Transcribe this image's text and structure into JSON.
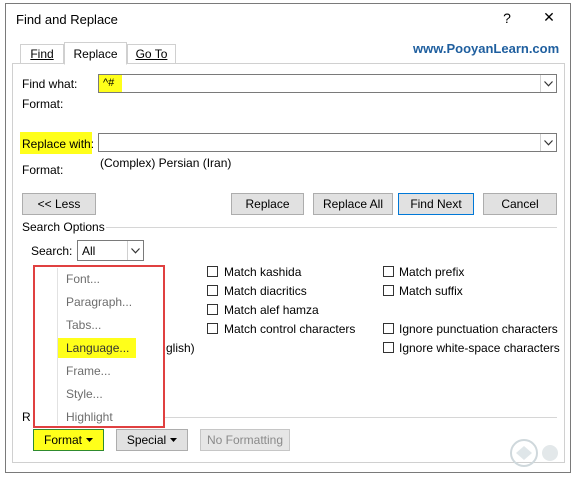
{
  "window": {
    "title": "Find and Replace",
    "help_glyph": "?",
    "close_glyph": "✕"
  },
  "tabs": [
    {
      "label": "Find"
    },
    {
      "label": "Replace"
    },
    {
      "label": "Go To"
    }
  ],
  "watermark": "www.PooyanLearn.com",
  "find": {
    "label": "Find what:",
    "value": "^#",
    "format_label": "Format:"
  },
  "replace": {
    "label": "Replace with:",
    "value": "",
    "format_label": "Format:",
    "format_value": "(Complex) Persian (Iran)"
  },
  "buttons": {
    "less": "<< Less",
    "replace": "Replace",
    "replace_all": "Replace All",
    "find_next": "Find Next",
    "cancel": "Cancel"
  },
  "search_options": {
    "heading": "Search Options",
    "search_label": "Search:",
    "search_value": "All"
  },
  "checkboxes_col1": [
    {
      "label": "Match kashida",
      "checked": false
    },
    {
      "label": "Match diacritics",
      "checked": false
    },
    {
      "label": "Match alef hamza",
      "checked": false
    },
    {
      "label": "Match control characters",
      "checked": false
    }
  ],
  "checkboxes_col2": [
    {
      "label": "Match prefix",
      "checked": false
    },
    {
      "label": "Match suffix",
      "checked": false
    },
    {
      "label": "Ignore punctuation characters",
      "checked": false
    },
    {
      "label": "Ignore white-space characters",
      "checked": false
    }
  ],
  "partial_text": {
    "english_fragment": "glish)",
    "replace_section_fragment": "R"
  },
  "format_menu": [
    "Font...",
    "Paragraph...",
    "Tabs...",
    "Language...",
    "Frame...",
    "Style...",
    "Highlight"
  ],
  "bottom_buttons": {
    "format": "Format",
    "special": "Special",
    "no_formatting": "No Formatting"
  },
  "colors": {
    "highlight": "#ffff1a",
    "menu_border": "#e04040",
    "watermark": "#1f5f9f"
  }
}
